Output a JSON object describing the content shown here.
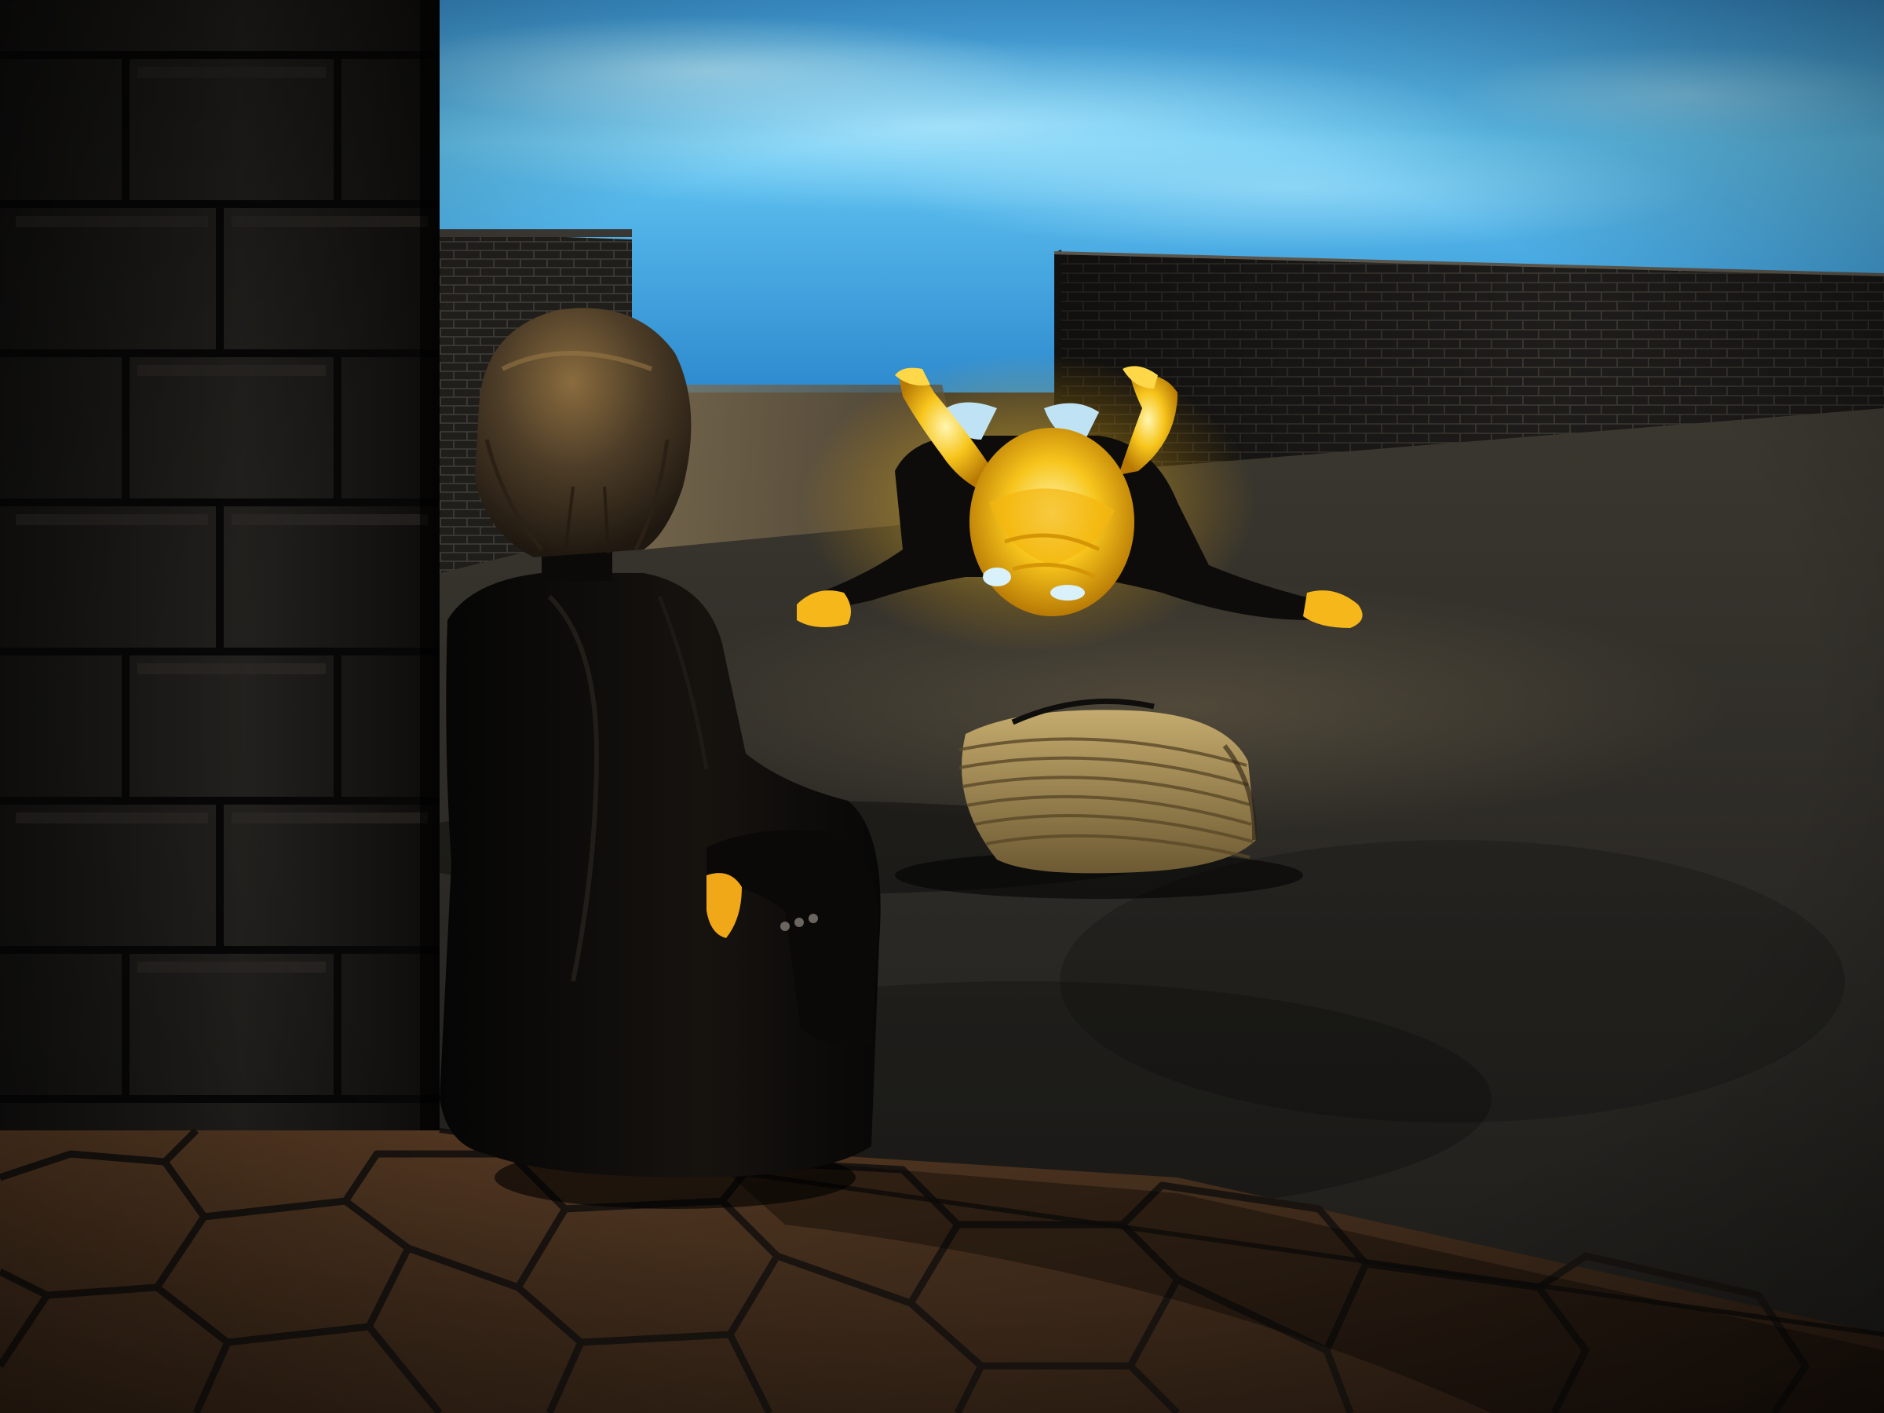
{
  "scene": {
    "palette": {
      "sky_top": "#3f9edf",
      "sky_mid": "#5cc4f2",
      "sky_bottom": "#2a86cc",
      "ground": "#2a2824",
      "ground_dark": "#141310",
      "wall": "#2c2a26",
      "wall_mortar": "#55514a",
      "pillar": "#1b1a18",
      "glow": "#f6c21a",
      "glow_core": "#ffe98a",
      "suit": "#0e0d0c",
      "hair": "#4a3b27",
      "basket": "#a48a52",
      "tile": "#4a3220",
      "tile_edge": "#191410"
    },
    "objects": [
      "sky",
      "brick-wall-left",
      "brick-wall-right",
      "courtyard-ground",
      "stone-pillar",
      "hexagon-tile-floor",
      "seated-figure",
      "glowing-fallen-figure",
      "straw-basket"
    ]
  }
}
